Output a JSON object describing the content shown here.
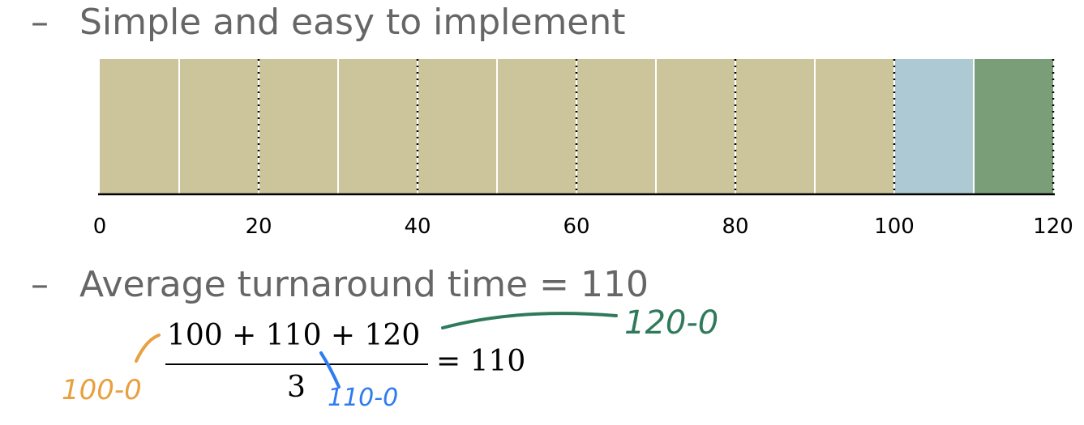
{
  "bullets": {
    "first": "Simple and easy to implement",
    "second": "Average turnaround time = 110"
  },
  "bullet_dash": "–",
  "chart_data": {
    "type": "bar",
    "orientation": "horizontal-timeline",
    "xlim": [
      0,
      120
    ],
    "ticks": [
      "0",
      "20",
      "40",
      "60",
      "80",
      "100",
      "120"
    ],
    "tick_values": [
      0,
      20,
      40,
      60,
      80,
      100,
      120
    ],
    "segments": [
      {
        "start": 0,
        "end": 10,
        "color": "#CCC59C"
      },
      {
        "start": 10,
        "end": 20,
        "color": "#CCC59C"
      },
      {
        "start": 20,
        "end": 30,
        "color": "#CCC59C"
      },
      {
        "start": 30,
        "end": 40,
        "color": "#CCC59C"
      },
      {
        "start": 40,
        "end": 50,
        "color": "#CCC59C"
      },
      {
        "start": 50,
        "end": 60,
        "color": "#CCC59C"
      },
      {
        "start": 60,
        "end": 70,
        "color": "#CCC59C"
      },
      {
        "start": 70,
        "end": 80,
        "color": "#CCC59C"
      },
      {
        "start": 80,
        "end": 90,
        "color": "#CCC59C"
      },
      {
        "start": 90,
        "end": 100,
        "color": "#CCC59C"
      },
      {
        "start": 100,
        "end": 110,
        "color": "#ADCAD4"
      },
      {
        "start": 110,
        "end": 120,
        "color": "#7A9F78"
      }
    ],
    "dotted_lines_at": [
      20,
      40,
      60,
      80,
      100,
      120
    ]
  },
  "formula": {
    "numerator": "100 + 110 + 120",
    "denominator": "3",
    "result": "= 110"
  },
  "annotations": {
    "orange": {
      "text": "100-0",
      "color": "#E8A040"
    },
    "blue": {
      "text": "110-0",
      "color": "#2F7BF0"
    },
    "green": {
      "text": "120-0",
      "color": "#2E7A5A"
    }
  }
}
